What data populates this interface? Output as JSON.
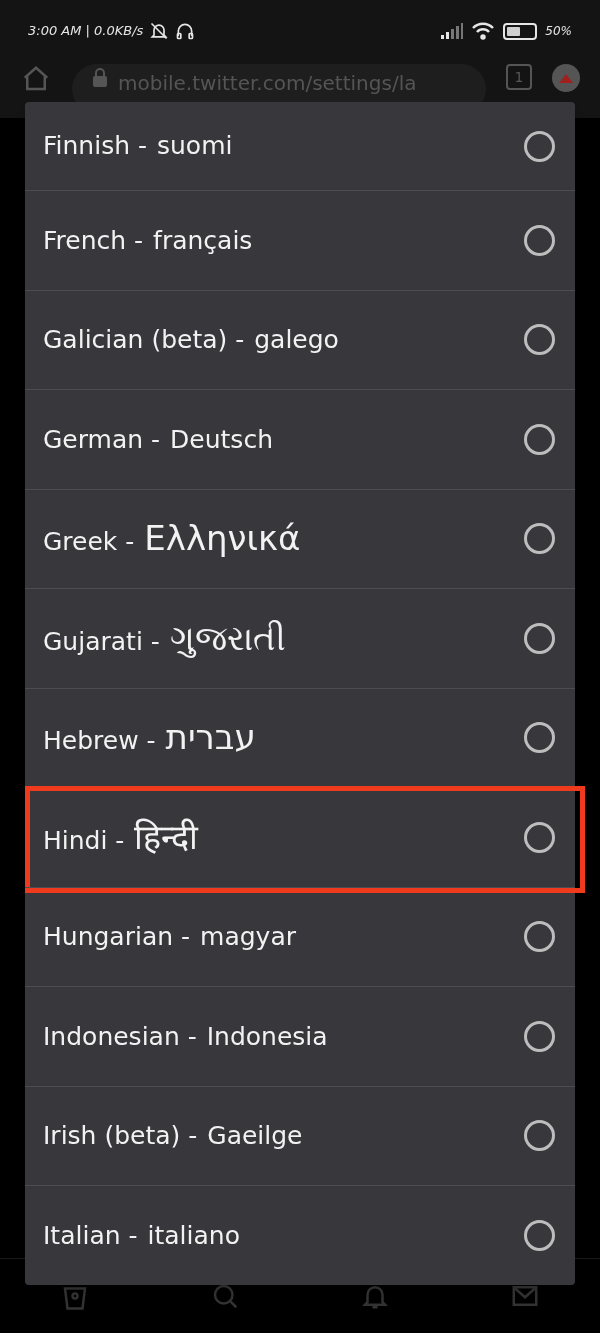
{
  "status_bar": {
    "time": "3:00 AM | 0.0KB/s",
    "battery": "50%"
  },
  "browser": {
    "url": "mobile.twitter.com/settings/la",
    "tab_count": "1"
  },
  "languages": [
    {
      "name": "Finnish -",
      "native": "suomi",
      "kind": "latin",
      "selected": false,
      "highlighted": false
    },
    {
      "name": "French -",
      "native": "français",
      "kind": "latin",
      "selected": false,
      "highlighted": false
    },
    {
      "name": "Galician (beta) -",
      "native": "galego",
      "kind": "latin",
      "selected": false,
      "highlighted": false
    },
    {
      "name": "German -",
      "native": "Deutsch",
      "kind": "latin",
      "selected": false,
      "highlighted": false
    },
    {
      "name": "Greek -",
      "native": "Ελληνικά",
      "kind": "script",
      "selected": false,
      "highlighted": false
    },
    {
      "name": "Gujarati -",
      "native": "ગુજરાતી",
      "kind": "script",
      "selected": false,
      "highlighted": false
    },
    {
      "name": "Hebrew -",
      "native": "עברית",
      "kind": "script",
      "selected": false,
      "highlighted": false
    },
    {
      "name": "Hindi -",
      "native": "हिन्दी",
      "kind": "script",
      "selected": false,
      "highlighted": true
    },
    {
      "name": "Hungarian -",
      "native": "magyar",
      "kind": "latin",
      "selected": false,
      "highlighted": false
    },
    {
      "name": "Indonesian -",
      "native": "Indonesia",
      "kind": "latin",
      "selected": false,
      "highlighted": false
    },
    {
      "name": "Irish (beta) -",
      "native": "Gaeilge",
      "kind": "latin",
      "selected": false,
      "highlighted": false
    },
    {
      "name": "Italian -",
      "native": "italiano",
      "kind": "latin",
      "selected": false,
      "highlighted": false
    }
  ]
}
